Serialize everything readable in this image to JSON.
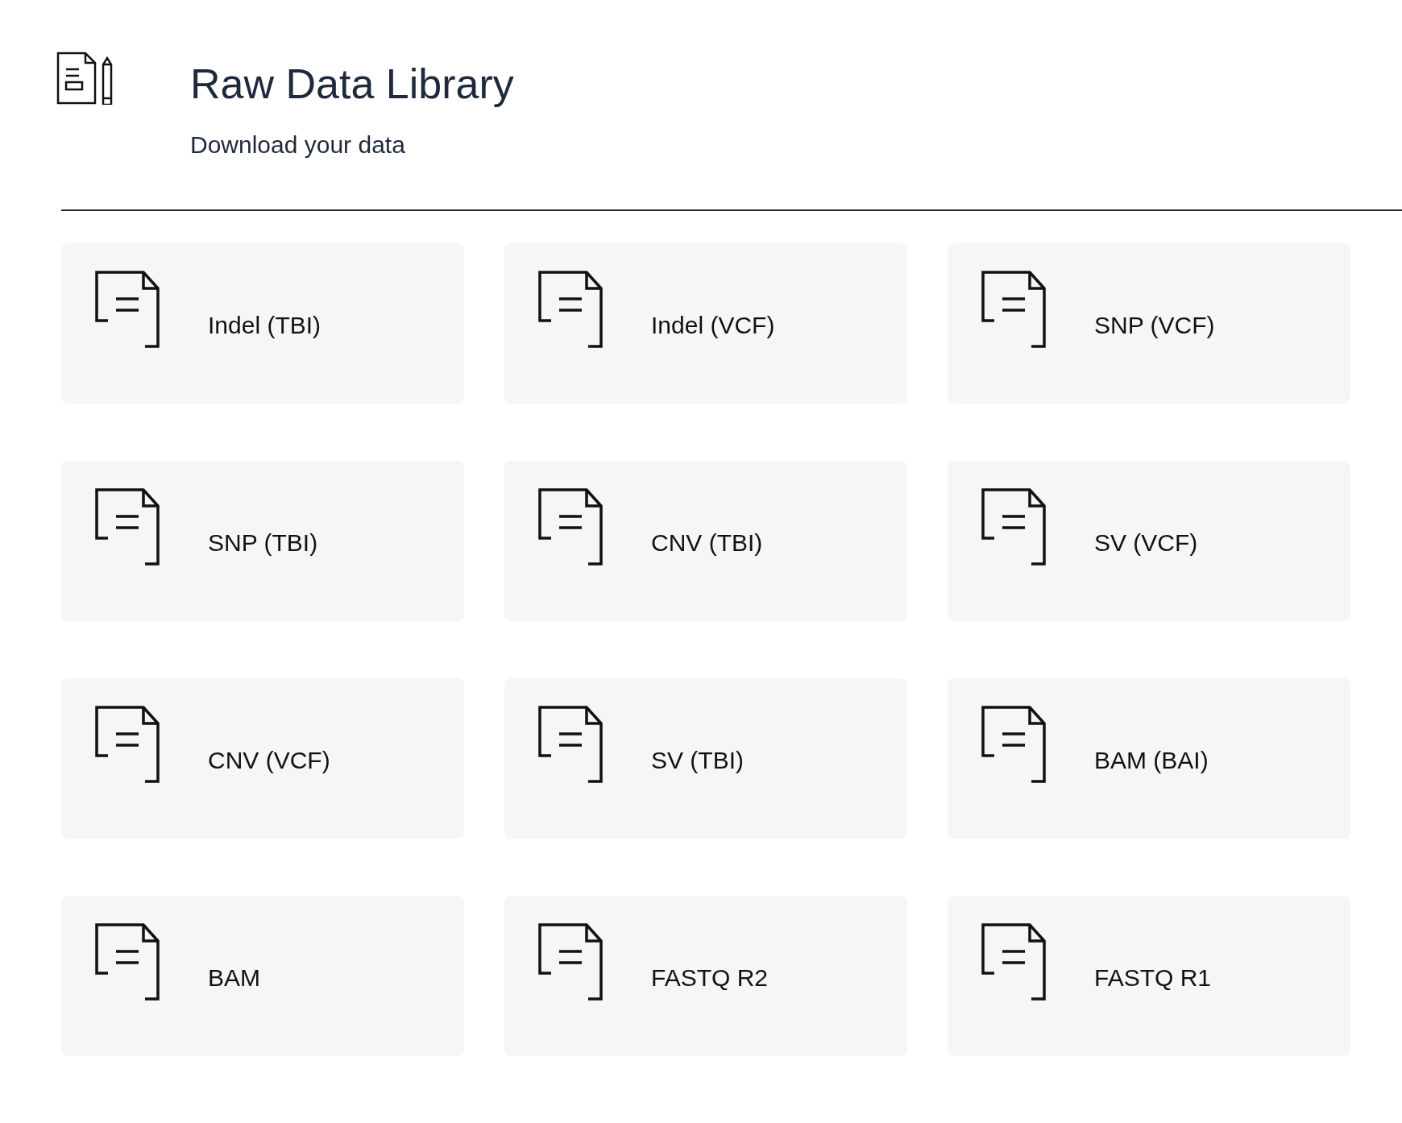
{
  "header": {
    "title": "Raw Data Library",
    "subtitle": "Download your data"
  },
  "files": [
    {
      "label": "Indel (TBI)"
    },
    {
      "label": "Indel (VCF)"
    },
    {
      "label": "SNP (VCF)"
    },
    {
      "label": "SNP (TBI)"
    },
    {
      "label": "CNV (TBI)"
    },
    {
      "label": "SV (VCF)"
    },
    {
      "label": "CNV (VCF)"
    },
    {
      "label": "SV (TBI)"
    },
    {
      "label": "BAM (BAI)"
    },
    {
      "label": "BAM"
    },
    {
      "label": "FASTQ R2"
    },
    {
      "label": "FASTQ R1"
    }
  ]
}
